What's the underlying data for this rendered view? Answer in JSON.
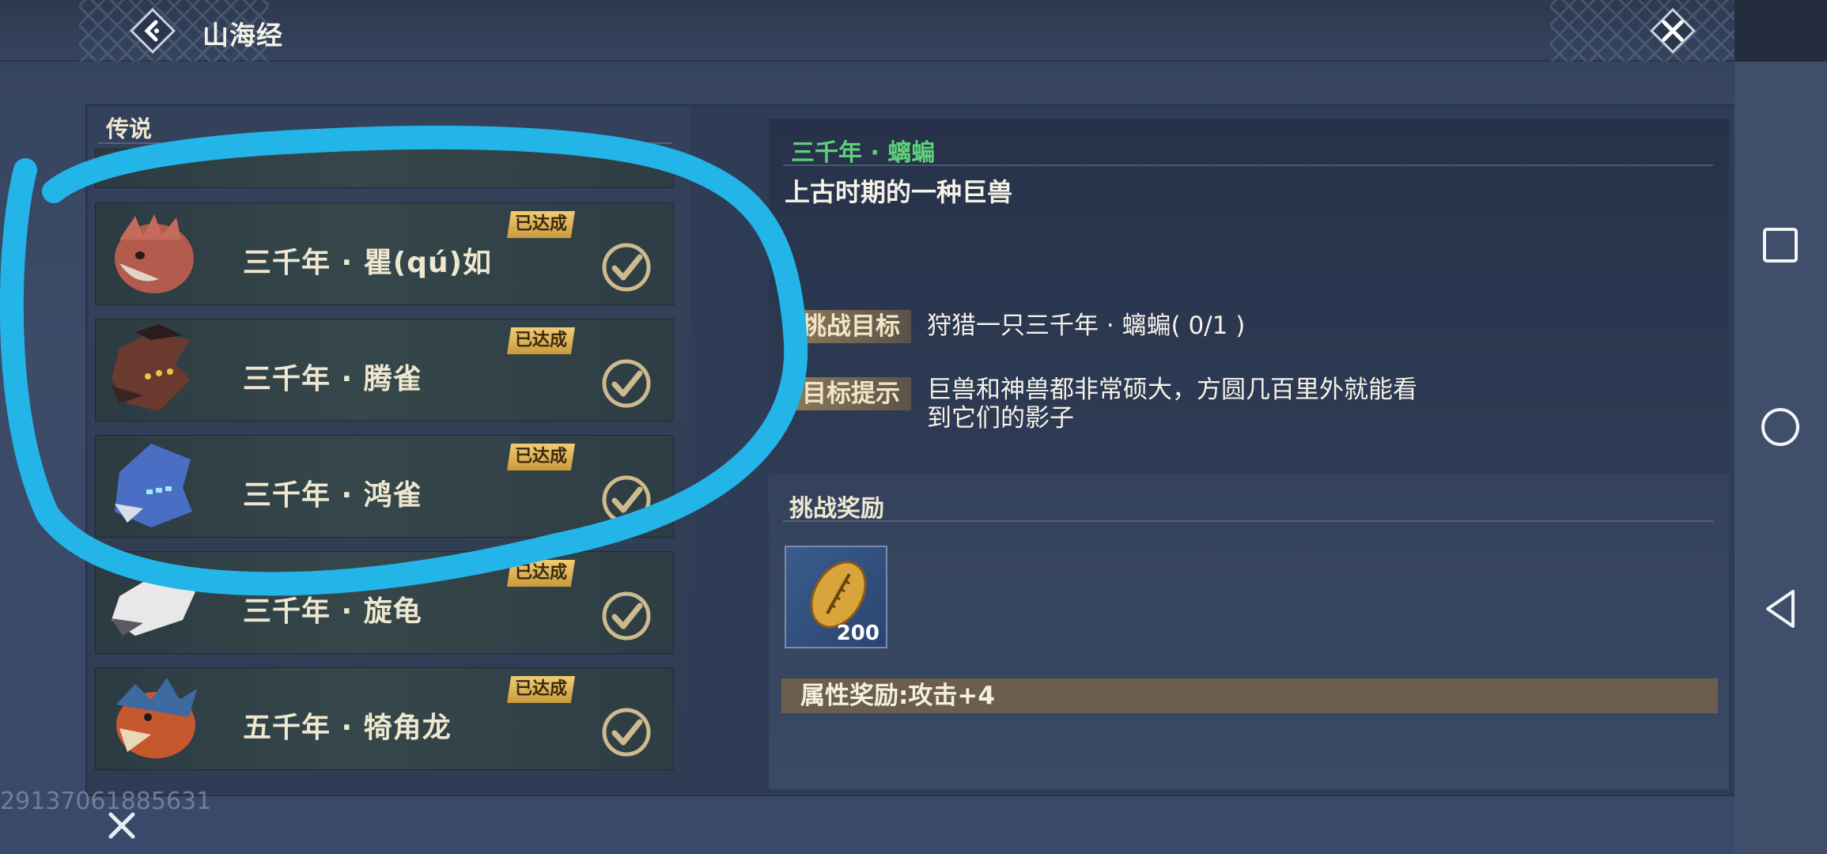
{
  "header": {
    "title": "山海经",
    "back_icon": "back-arrow-icon",
    "close_icon": "close-icon"
  },
  "list": {
    "category": "传说",
    "entries": [
      {
        "name": "三千年 · 瞿(qú)如",
        "status": "已达成"
      },
      {
        "name": "三千年 · 腾雀",
        "status": "已达成"
      },
      {
        "name": "三千年 · 鸿雀",
        "status": "已达成"
      },
      {
        "name": "三千年 · 旋龟",
        "status": "已达成"
      },
      {
        "name": "五千年 · 犄角龙",
        "status": "已达成"
      }
    ]
  },
  "detail": {
    "subtitle": "三千年 · 螭蝙",
    "description": "上古时期的一种巨兽",
    "goal_label": "挑战目标",
    "goal_text": "狩猎一只三千年 · 螭蝙( 0/1 )",
    "hint_label": "目标提示",
    "hint_text_1": "巨兽和神兽都非常硕大，方圆几百里外就能看",
    "hint_text_2": "到它们的影子"
  },
  "reward": {
    "header": "挑战奖励",
    "item_qty": "200",
    "attribute": "属性奖励:攻击+4"
  },
  "footer": {
    "uid": "29137061885631"
  },
  "colors": {
    "accent_green": "#5fd07a",
    "badge_gold": "#e6bb5c",
    "annotation_blue": "#23b4e8"
  }
}
